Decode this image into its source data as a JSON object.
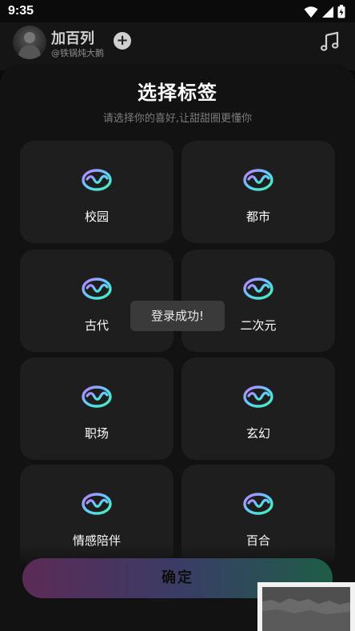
{
  "status_bar": {
    "time": "9:35"
  },
  "header": {
    "author_name": "加百列",
    "author_handle": "@铁锅炖大鹅",
    "follow_symbol": "+"
  },
  "sheet": {
    "title": "选择标签",
    "subtitle": "请选择你的喜好,让甜甜圈更懂你",
    "tags": [
      {
        "label": "校园",
        "icon": "donut-logo-icon"
      },
      {
        "label": "都市",
        "icon": "donut-logo-icon"
      },
      {
        "label": "古代",
        "icon": "donut-logo-icon"
      },
      {
        "label": "二次元",
        "icon": "donut-logo-icon"
      },
      {
        "label": "职场",
        "icon": "donut-logo-icon"
      },
      {
        "label": "玄幻",
        "icon": "donut-logo-icon"
      },
      {
        "label": "情感陪伴",
        "icon": "donut-logo-icon"
      },
      {
        "label": "百合",
        "icon": "donut-logo-icon"
      }
    ],
    "confirm_label": "确定"
  },
  "toast": {
    "message": "登录成功!"
  },
  "colors": {
    "background": "#0b0b0b",
    "sheet": "#121212",
    "card": "#1e1e1e",
    "icon_gradient": [
      "#c07bff",
      "#5fd0ff",
      "#44f0b0"
    ],
    "confirm_gradient": [
      "#5b2b56",
      "#3a3c66",
      "#1e5d46"
    ]
  }
}
